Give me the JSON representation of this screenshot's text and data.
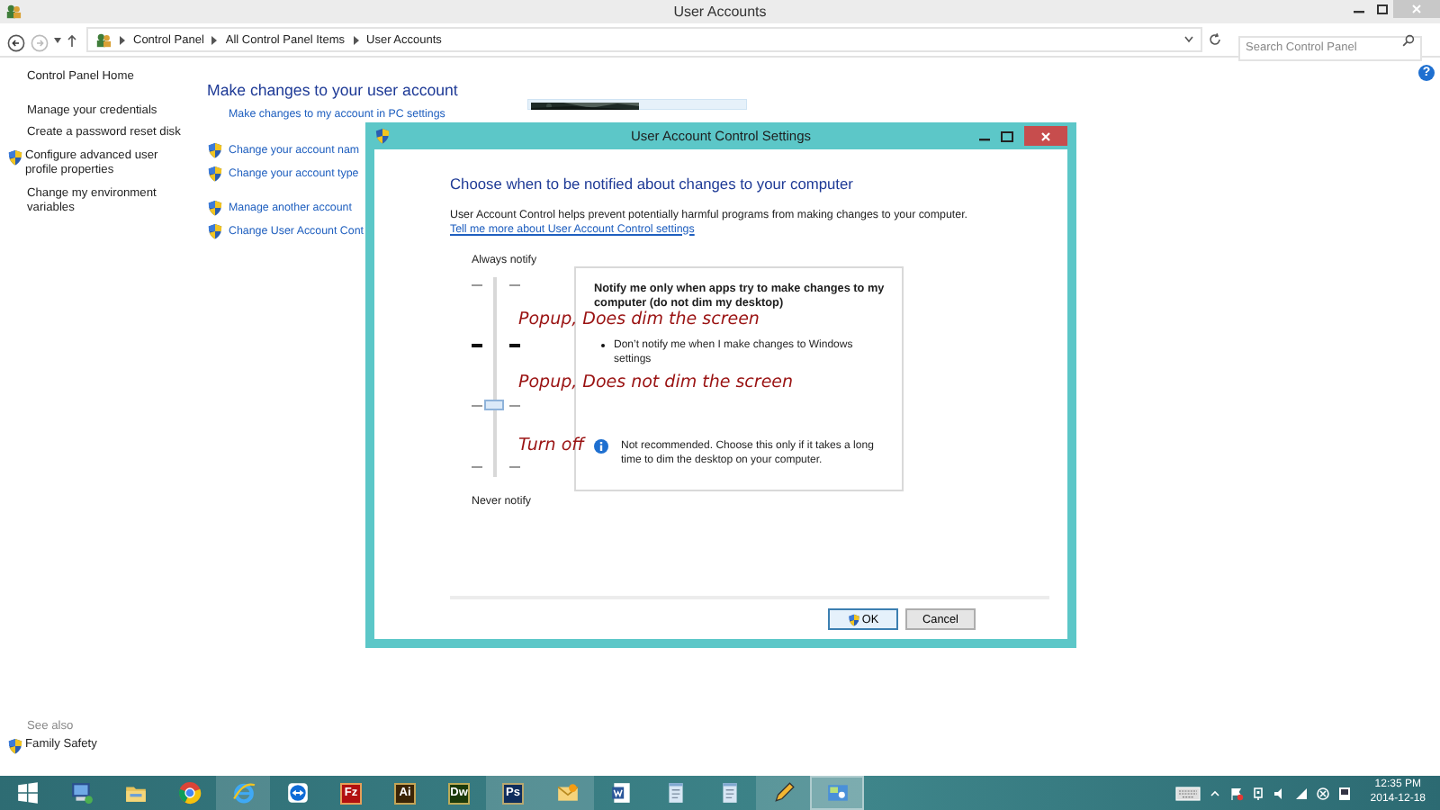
{
  "window": {
    "title": "User Accounts"
  },
  "address_bar": {
    "path": [
      "Control Panel",
      "All Control Panel Items",
      "User Accounts"
    ],
    "search": {
      "placeholder": "Search Control Panel"
    }
  },
  "help": {
    "label": "?"
  },
  "sidebar": {
    "items": [
      {
        "label": "Control Panel Home",
        "shield": false
      },
      {
        "label": "Manage your credentials",
        "shield": false
      },
      {
        "label": "Create a password reset disk",
        "shield": false
      },
      {
        "label": "Configure advanced user profile properties",
        "shield": true
      },
      {
        "label": "Change my environment variables",
        "shield": false
      }
    ],
    "see_also": {
      "title": "See also",
      "items": [
        {
          "label": "Family Safety",
          "shield": true
        }
      ]
    }
  },
  "main": {
    "heading": "Make changes to your user account",
    "link_groups": [
      [
        {
          "label": "Make changes to my account in PC settings",
          "shield": false
        }
      ],
      [
        {
          "label": "Change your account nam",
          "shield": true
        },
        {
          "label": "Change your account type",
          "shield": true
        }
      ],
      [
        {
          "label": "Manage another account",
          "shield": true
        },
        {
          "label": "Change User Account Cont",
          "shield": true
        }
      ]
    ]
  },
  "dialog": {
    "title": "User Account Control Settings",
    "heading": "Choose when to be notified about changes to your computer",
    "description": "User Account Control helps prevent potentially harmful programs from making changes to your computer.",
    "link": "Tell me more about User Account Control settings",
    "slider": {
      "top_label": "Always notify",
      "bottom_label": "Never notify",
      "level": 0.333,
      "steps": [
        {
          "bold": false
        },
        {
          "bold": true
        },
        {
          "bold": false
        },
        {
          "bold": false
        }
      ]
    },
    "annotations": [
      "Popup, Does dim the screen",
      "Popup, Does not dim the screen",
      "Turn off"
    ],
    "info": {
      "title": "Notify me only when apps try to make changes to my computer (do not dim my desktop)",
      "bullets": [
        "Don’t notify me when I make changes to Windows settings"
      ],
      "note": "Not recommended. Choose this only if it takes a long time to dim the desktop on your computer."
    },
    "buttons": [
      {
        "label": "OK",
        "shield": true,
        "default": true
      },
      {
        "label": "Cancel",
        "shield": false,
        "default": false
      }
    ]
  },
  "taskbar": {
    "items": [
      {
        "kind": "windows",
        "running": false,
        "selected": false
      },
      {
        "kind": "monitor",
        "running": false,
        "selected": false
      },
      {
        "kind": "folder",
        "running": false,
        "selected": false
      },
      {
        "kind": "chrome",
        "running": false,
        "selected": false
      },
      {
        "kind": "ie",
        "running": true,
        "selected": false
      },
      {
        "kind": "teamviewer",
        "running": false,
        "selected": false
      },
      {
        "kind": "app",
        "label": "Fz",
        "color": "#b21010",
        "running": false,
        "selected": false
      },
      {
        "kind": "app",
        "label": "Ai",
        "color": "#3a2406",
        "running": false,
        "selected": false
      },
      {
        "kind": "app",
        "label": "Dw",
        "color": "#1c3a0a",
        "running": false,
        "selected": false
      },
      {
        "kind": "app",
        "label": "Ps",
        "color": "#0f2d5c",
        "running": true,
        "selected": false
      },
      {
        "kind": "envelope",
        "running": true,
        "selected": false
      },
      {
        "kind": "document",
        "running": false,
        "selected": false
      },
      {
        "kind": "notepad",
        "running": false,
        "selected": false
      },
      {
        "kind": "notepad",
        "running": false,
        "selected": false
      },
      {
        "kind": "pencil",
        "running": true,
        "selected": false
      },
      {
        "kind": "control-panel",
        "running": true,
        "selected": true
      }
    ],
    "clock": {
      "time": "12:35 PM",
      "date": "2014-12-18"
    }
  }
}
